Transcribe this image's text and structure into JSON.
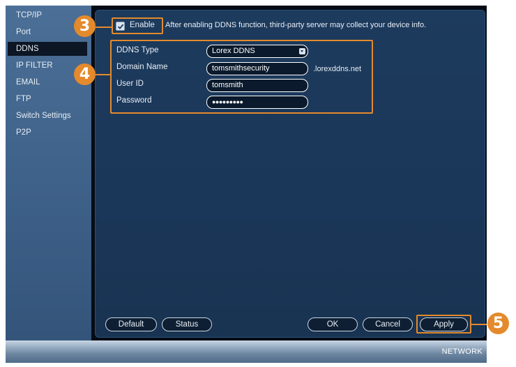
{
  "sidebar": {
    "items": [
      {
        "label": "TCP/IP"
      },
      {
        "label": "Port"
      },
      {
        "label": "DDNS"
      },
      {
        "label": "IP FILTER"
      },
      {
        "label": "EMAIL"
      },
      {
        "label": "FTP"
      },
      {
        "label": "Switch Settings"
      },
      {
        "label": "P2P"
      }
    ],
    "active_index": 2
  },
  "ddns": {
    "enable_checked": true,
    "enable_label": "Enable",
    "enable_note": "After enabling DDNS function, third-party server may collect your device info.",
    "fields": {
      "type_label": "DDNS Type",
      "type_value": "Lorex DDNS",
      "domain_label": "Domain Name",
      "domain_value": "tomsmithsecurity",
      "domain_suffix": ".lorexddns.net",
      "user_label": "User ID",
      "user_value": "tomsmith",
      "password_label": "Password",
      "password_value": "●●●●●●●●●"
    }
  },
  "buttons": {
    "default": "Default",
    "status": "Status",
    "ok": "OK",
    "cancel": "Cancel",
    "apply": "Apply"
  },
  "callouts": {
    "enable": "3",
    "fields": "4",
    "apply": "5"
  },
  "footer": {
    "section_label": "NETWORK"
  },
  "colors": {
    "callout": "#e48a2c",
    "panel": "#1a3658",
    "sidebar": "#43678e"
  }
}
